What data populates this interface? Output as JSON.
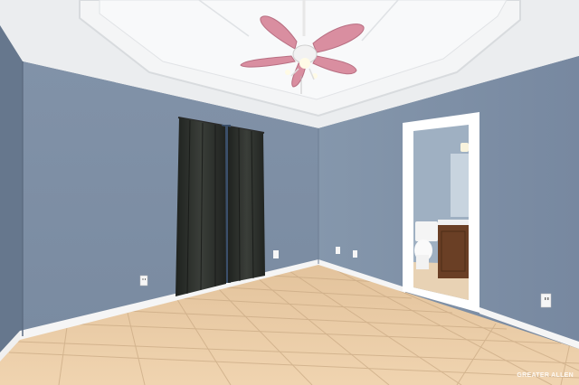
{
  "watermark": {
    "text": "GREATER ALLEN"
  },
  "colors": {
    "wall": "#7d8ea5",
    "wall_dark": "#6c7d93",
    "ceiling": "#eef0f2",
    "floor": "#e7c9a4",
    "trim": "#ffffff",
    "curtain": "#2b2e2a",
    "fan_blade": "#d98ea0",
    "vanity": "#6a3f25"
  },
  "icons": [
    "ceiling-fan-icon",
    "power-outlet-icon"
  ]
}
